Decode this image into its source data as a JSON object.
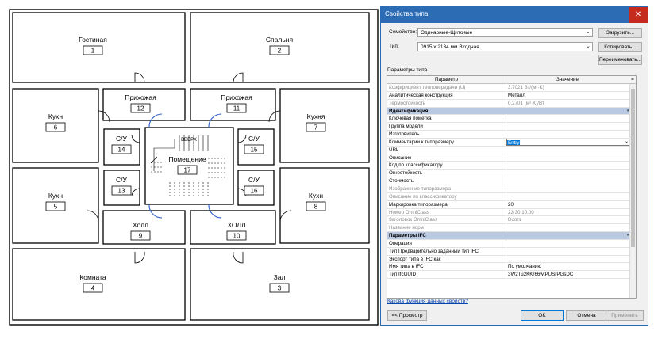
{
  "plan": {
    "rooms": [
      {
        "name": "Гостиная",
        "number": "1"
      },
      {
        "name": "Спальня",
        "number": "2"
      },
      {
        "name": "Комната",
        "number": "4"
      },
      {
        "name": "Зал",
        "number": "3"
      },
      {
        "name": "Кухн",
        "number": "6"
      },
      {
        "name": "Кухня",
        "number": "7"
      },
      {
        "name": "Кухн",
        "number": "5"
      },
      {
        "name": "Кухн",
        "number": "8"
      },
      {
        "name": "Прихожая",
        "number": "12"
      },
      {
        "name": "Прихожая",
        "number": "11"
      },
      {
        "name": "С/У",
        "number": "14"
      },
      {
        "name": "С/У",
        "number": "15"
      },
      {
        "name": "С/У",
        "number": "13"
      },
      {
        "name": "С/У",
        "number": "16"
      },
      {
        "name": "Помещение",
        "number": "17"
      },
      {
        "name": "Холл",
        "number": "9"
      },
      {
        "name": "ХОЛЛ",
        "number": "10"
      }
    ],
    "stair_label": "ВВЕРХ"
  },
  "dialog": {
    "title": "Свойства типа",
    "close_glyph": "✕",
    "family_label": "Семейство:",
    "family_value": "Одинарные-Щитовые",
    "type_label": "Тип:",
    "type_value": "0915 x 2134 мм  Входная",
    "load_button": "Загрузить...",
    "copy_button": "Копировать...",
    "rename_button": "Переименовать...",
    "section_label": "Параметры типа",
    "col_param": "Параметр",
    "col_value": "Значение",
    "col_eq": "=",
    "rows": [
      {
        "kind": "param",
        "name": "Коэффициент теплопередачи (U)",
        "value": "3.7021 Вт/(м²·K)",
        "dim": true,
        "check": false
      },
      {
        "kind": "param",
        "name": "Аналитическая конструкция",
        "value": "Металл",
        "dim": false,
        "check": false
      },
      {
        "kind": "param",
        "name": "Термостойкость",
        "value": "0.2701 (м²·K)/Вт",
        "dim": true,
        "check": false
      },
      {
        "kind": "group",
        "name": "Идентификация",
        "collapse": "«"
      },
      {
        "kind": "param",
        "name": "Ключевая пометка",
        "value": "",
        "dim": false,
        "check": true
      },
      {
        "kind": "param",
        "name": "Группа модели",
        "value": "",
        "dim": false,
        "check": true
      },
      {
        "kind": "param",
        "name": "Изготовитель",
        "value": "",
        "dim": false,
        "check": true
      },
      {
        "kind": "edit",
        "name": "Комментарии к типоразмеру",
        "value": "Entry",
        "dim": false,
        "check": true
      },
      {
        "kind": "param",
        "name": "URL",
        "value": "",
        "dim": false,
        "check": true
      },
      {
        "kind": "param",
        "name": "Описание",
        "value": "",
        "dim": false,
        "check": true
      },
      {
        "kind": "param",
        "name": "Код по классификатору",
        "value": "",
        "dim": false,
        "check": true
      },
      {
        "kind": "param",
        "name": "Огнестойкость",
        "value": "",
        "dim": false,
        "check": true
      },
      {
        "kind": "param",
        "name": "Стоимость",
        "value": "",
        "dim": false,
        "check": true
      },
      {
        "kind": "param",
        "name": "Изображение типоразмера",
        "value": "",
        "dim": true,
        "check": false
      },
      {
        "kind": "param",
        "name": "Описание по классификатору",
        "value": "",
        "dim": true,
        "check": false
      },
      {
        "kind": "param",
        "name": "Маркировка типоразмера",
        "value": "20",
        "dim": false,
        "check": false
      },
      {
        "kind": "param",
        "name": "Номер OmniClass",
        "value": "23.30.10.00",
        "dim": true,
        "check": false
      },
      {
        "kind": "param",
        "name": "Заголовок OmniClass",
        "value": "Doors",
        "dim": true,
        "check": false
      },
      {
        "kind": "param",
        "name": "Название норм",
        "value": "",
        "dim": true,
        "check": false
      },
      {
        "kind": "group",
        "name": "Параметры IFC",
        "collapse": "«"
      },
      {
        "kind": "param",
        "name": "Операция",
        "value": "",
        "dim": false,
        "check": true
      },
      {
        "kind": "param",
        "name": "Тип Предварительно заданный тип IFC",
        "value": "",
        "dim": false,
        "check": true
      },
      {
        "kind": "param",
        "name": "Экспорт типа в IFC как",
        "value": "",
        "dim": false,
        "check": true
      },
      {
        "kind": "param",
        "name": "Имя типа в IFC",
        "value": "По умолчанию",
        "dim": false,
        "check": true
      },
      {
        "kind": "param",
        "name": "Тип IfcGUID",
        "value": "3W2Tu2KKr66wtPUSrPGsDC",
        "dim": false,
        "check": false
      }
    ],
    "help_link": "Какова функция данных свойств?",
    "preview_button": "<< Просмотр",
    "ok_button": "OK",
    "cancel_button": "Отмена",
    "apply_button": "Применить"
  }
}
